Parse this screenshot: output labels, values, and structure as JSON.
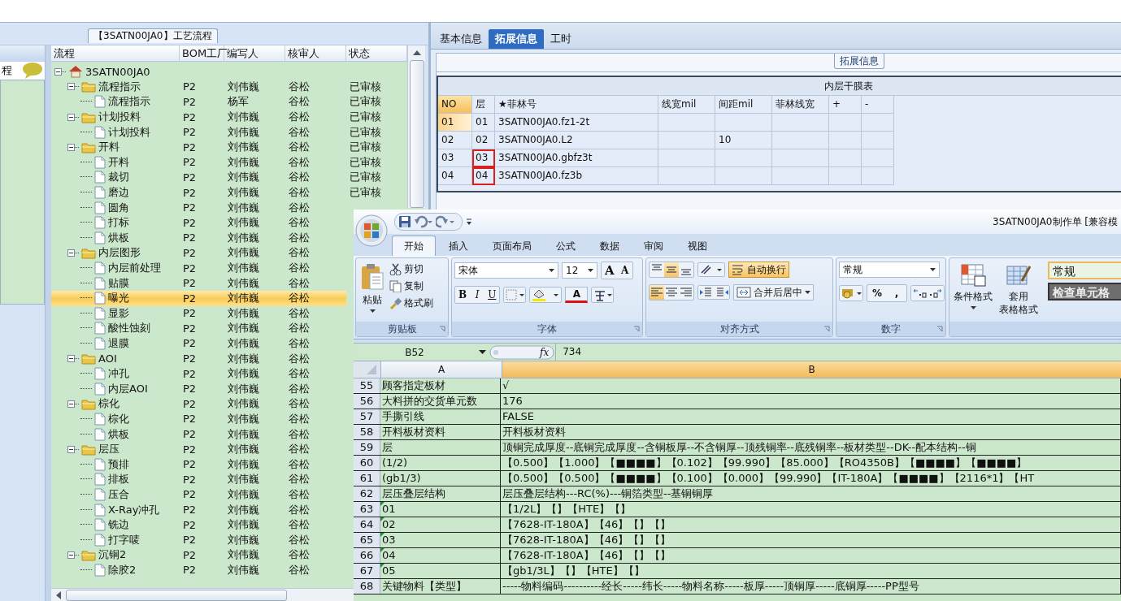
{
  "sidebar": {
    "label": "程"
  },
  "process_panel": {
    "title": "【3SATN00JA0】工艺流程",
    "columns": [
      "流程",
      "BOM工厂",
      "编写人",
      "核审人",
      "状态"
    ],
    "tree": [
      {
        "name": "3SATN00JA0",
        "kind": "root",
        "expanded": true,
        "selected": false,
        "children": [
          {
            "name": "流程指示",
            "kind": "folder",
            "expanded": true,
            "selected": false,
            "bom": "P2",
            "author": "刘伟巍",
            "reviewer": "谷松",
            "status": "已审核",
            "children": [
              {
                "name": "流程指示",
                "kind": "file",
                "selected": false,
                "bom": "P2",
                "author": "杨军",
                "reviewer": "谷松",
                "status": "已审核"
              }
            ]
          },
          {
            "name": "计划投料",
            "kind": "folder",
            "expanded": true,
            "selected": false,
            "bom": "P2",
            "author": "刘伟巍",
            "reviewer": "谷松",
            "status": "已审核",
            "children": [
              {
                "name": "计划投料",
                "kind": "file",
                "selected": false,
                "bom": "P2",
                "author": "刘伟巍",
                "reviewer": "谷松",
                "status": "已审核"
              }
            ]
          },
          {
            "name": "开料",
            "kind": "folder",
            "expanded": true,
            "selected": false,
            "bom": "P2",
            "author": "刘伟巍",
            "reviewer": "谷松",
            "status": "已审核",
            "children": [
              {
                "name": "开料",
                "kind": "file",
                "selected": false,
                "bom": "P2",
                "author": "刘伟巍",
                "reviewer": "谷松",
                "status": "已审核"
              },
              {
                "name": "裁切",
                "kind": "file",
                "selected": false,
                "bom": "P2",
                "author": "刘伟巍",
                "reviewer": "谷松",
                "status": "已审核"
              },
              {
                "name": "磨边",
                "kind": "file",
                "selected": false,
                "bom": "P2",
                "author": "刘伟巍",
                "reviewer": "谷松",
                "status": "已审核"
              },
              {
                "name": "圆角",
                "kind": "file",
                "selected": false,
                "bom": "P2",
                "author": "刘伟巍",
                "reviewer": "谷松"
              },
              {
                "name": "打标",
                "kind": "file",
                "selected": false,
                "bom": "P2",
                "author": "刘伟巍",
                "reviewer": "谷松"
              },
              {
                "name": "烘板",
                "kind": "file",
                "selected": false,
                "bom": "P2",
                "author": "刘伟巍",
                "reviewer": "谷松"
              }
            ]
          },
          {
            "name": "内层图形",
            "kind": "folder",
            "expanded": true,
            "selected": false,
            "bom": "P2",
            "author": "刘伟巍",
            "reviewer": "谷松",
            "children": [
              {
                "name": "内层前处理",
                "kind": "file",
                "selected": false,
                "bom": "P2",
                "author": "刘伟巍",
                "reviewer": "谷松"
              },
              {
                "name": "贴膜",
                "kind": "file",
                "selected": false,
                "bom": "P2",
                "author": "刘伟巍",
                "reviewer": "谷松"
              },
              {
                "name": "曝光",
                "kind": "file",
                "selected": true,
                "bom": "P2",
                "author": "刘伟巍",
                "reviewer": "谷松"
              },
              {
                "name": "显影",
                "kind": "file",
                "selected": false,
                "bom": "P2",
                "author": "刘伟巍",
                "reviewer": "谷松"
              },
              {
                "name": "酸性蚀刻",
                "kind": "file",
                "selected": false,
                "bom": "P2",
                "author": "刘伟巍",
                "reviewer": "谷松"
              },
              {
                "name": "退膜",
                "kind": "file",
                "selected": false,
                "bom": "P2",
                "author": "刘伟巍",
                "reviewer": "谷松"
              }
            ]
          },
          {
            "name": "AOI",
            "kind": "folder",
            "expanded": true,
            "selected": false,
            "bom": "P2",
            "author": "刘伟巍",
            "reviewer": "谷松",
            "children": [
              {
                "name": "冲孔",
                "kind": "file",
                "selected": false,
                "bom": "P2",
                "author": "刘伟巍",
                "reviewer": "谷松"
              },
              {
                "name": "内层AOI",
                "kind": "file",
                "selected": false,
                "bom": "P2",
                "author": "刘伟巍",
                "reviewer": "谷松"
              }
            ]
          },
          {
            "name": "棕化",
            "kind": "folder",
            "expanded": true,
            "selected": false,
            "bom": "P2",
            "author": "刘伟巍",
            "reviewer": "谷松",
            "children": [
              {
                "name": "棕化",
                "kind": "file",
                "selected": false,
                "bom": "P2",
                "author": "刘伟巍",
                "reviewer": "谷松"
              },
              {
                "name": "烘板",
                "kind": "file",
                "selected": false,
                "bom": "P2",
                "author": "刘伟巍",
                "reviewer": "谷松"
              }
            ]
          },
          {
            "name": "层压",
            "kind": "folder",
            "expanded": true,
            "selected": false,
            "bom": "P2",
            "author": "刘伟巍",
            "reviewer": "谷松",
            "children": [
              {
                "name": "预排",
                "kind": "file",
                "selected": false,
                "bom": "P2",
                "author": "刘伟巍",
                "reviewer": "谷松"
              },
              {
                "name": "排板",
                "kind": "file",
                "selected": false,
                "bom": "P2",
                "author": "刘伟巍",
                "reviewer": "谷松"
              },
              {
                "name": "压合",
                "kind": "file",
                "selected": false,
                "bom": "P2",
                "author": "刘伟巍",
                "reviewer": "谷松"
              },
              {
                "name": "X-Ray冲孔",
                "kind": "file",
                "selected": false,
                "bom": "P2",
                "author": "刘伟巍",
                "reviewer": "谷松"
              },
              {
                "name": "铣边",
                "kind": "file",
                "selected": false,
                "bom": "P2",
                "author": "刘伟巍",
                "reviewer": "谷松"
              },
              {
                "name": "打字唛",
                "kind": "file",
                "selected": false,
                "bom": "P2",
                "author": "刘伟巍",
                "reviewer": "谷松"
              }
            ]
          },
          {
            "name": "沉铜2",
            "kind": "folder",
            "expanded": true,
            "selected": false,
            "bom": "P2",
            "author": "刘伟巍",
            "reviewer": "谷松",
            "children": [
              {
                "name": "除胶2",
                "kind": "file",
                "selected": false,
                "bom": "P2",
                "author": "刘伟巍",
                "reviewer": "谷松"
              }
            ]
          }
        ]
      }
    ]
  },
  "info_panel": {
    "tabs": [
      {
        "label": "基本信息",
        "selected": false
      },
      {
        "label": "拓展信息",
        "selected": true
      },
      {
        "label": "工时",
        "selected": false
      }
    ],
    "group_title": "拓展信息",
    "table": {
      "caption": "内层干膜表",
      "columns": [
        {
          "label": "NO",
          "selected": true
        },
        {
          "label": "层",
          "selected": false
        },
        {
          "label": "★菲林号",
          "selected": false
        },
        {
          "label": "线宽mil",
          "selected": false
        },
        {
          "label": "间距mil",
          "selected": false
        },
        {
          "label": "菲林线宽",
          "selected": false
        },
        {
          "label": "+",
          "selected": false
        },
        {
          "label": "-",
          "selected": false
        }
      ],
      "rows": [
        {
          "no": "01",
          "layer": "01",
          "film": "3SATN00JA0.fz1-2t",
          "selected": true,
          "highlighted": false
        },
        {
          "no": "02",
          "layer": "02",
          "film": "3SATN00JA0.L2",
          "spacing": "10",
          "selected": false,
          "highlighted": false
        },
        {
          "no": "03",
          "layer": "03",
          "film": "3SATN00JA0.gbfz3t",
          "selected": false,
          "highlighted": true
        },
        {
          "no": "04",
          "layer": "04",
          "film": "3SATN00JA0.fz3b",
          "selected": false,
          "highlighted": true
        }
      ]
    }
  },
  "excel": {
    "title": "3SATN00JA0制作单  [兼容模",
    "tabs": [
      {
        "label": "开始",
        "selected": true
      },
      {
        "label": "插入",
        "selected": false
      },
      {
        "label": "页面布局",
        "selected": false
      },
      {
        "label": "公式",
        "selected": false
      },
      {
        "label": "数据",
        "selected": false
      },
      {
        "label": "审阅",
        "selected": false
      },
      {
        "label": "视图",
        "selected": false
      }
    ],
    "clipboard": {
      "label": "剪贴板",
      "paste": "粘贴",
      "cut": "剪切",
      "copy": "复制",
      "format_painter": "格式刷"
    },
    "font": {
      "label": "字体",
      "name": "宋体",
      "size": "12",
      "grow": "A",
      "shrink": "A",
      "bold": "B",
      "italic": "I",
      "underline": "U",
      "font_color": "A"
    },
    "alignment": {
      "label": "对齐方式",
      "vertical": [
        {
          "selected": false
        },
        {
          "selected": true
        },
        {
          "selected": false
        }
      ],
      "horizontal": [
        {
          "selected": true
        },
        {
          "selected": false
        },
        {
          "selected": false
        }
      ],
      "wrap_text": "自动换行",
      "wrap_on": true,
      "merge": "合并后居中"
    },
    "number": {
      "label": "数字",
      "format": "常规",
      "percent": "%",
      "comma": ","
    },
    "styles": {
      "conditional": "条件格式",
      "table_format": [
        "套用",
        "表格格式"
      ],
      "normal": "常规",
      "check_cell": "检查单元格"
    },
    "formula_bar": {
      "cell": "B52",
      "fx": "fx",
      "value": "734"
    },
    "sheet": {
      "columns": [
        {
          "label": "A",
          "selected": false
        },
        {
          "label": "B",
          "selected": true
        }
      ],
      "rows": [
        {
          "num": "55",
          "a": "顾客指定板材",
          "b": "√",
          "marked": false
        },
        {
          "num": "56",
          "a": "大料拼的交货单元数",
          "b": "176",
          "marked": false
        },
        {
          "num": "57",
          "a": "手撕引线",
          "b": "FALSE",
          "marked": false
        },
        {
          "num": "58",
          "a": "开料板材资料",
          "b": "开料板材资料",
          "marked": false
        },
        {
          "num": "59",
          "a": "层",
          "b": "顶铜完成厚度--底铜完成厚度--含铜板厚--不含铜厚--顶残铜率--底残铜率--板材类型--DK--配本结构--铜",
          "marked": false
        },
        {
          "num": "60",
          "a": "(1/2)",
          "b": "【0.500】【1.000】【■■■■】【0.102】【99.990】【85.000】【RO4350B】【■■■■】【■■■■】",
          "marked": false
        },
        {
          "num": "61",
          "a": "(gb1/3)",
          "b": "【0.500】【0.500】【■■■■】【0.100】【0.000】【99.990】【IT-180A】【■■■■】【2116*1】【HT",
          "marked": false
        },
        {
          "num": "62",
          "a": "层压叠层结构",
          "b": "层压叠层结构---RC(%)---铜箔类型--基铜铜厚",
          "marked": false
        },
        {
          "num": "63",
          "a": "01",
          "b": "【1/2L】【】【HTE】【】",
          "marked": true
        },
        {
          "num": "64",
          "a": "02",
          "b": "【7628-IT-180A】【46】【】【】",
          "marked": true
        },
        {
          "num": "65",
          "a": "03",
          "b": "【7628-IT-180A】【46】【】【】",
          "marked": true
        },
        {
          "num": "66",
          "a": "04",
          "b": "【7628-IT-180A】【46】【】【】",
          "marked": true
        },
        {
          "num": "67",
          "a": "05",
          "b": "【gb1/3L】【】【HTE】【】",
          "marked": true
        },
        {
          "num": "68",
          "a": "关键物料【类型】",
          "b": "-----物料编码----------经长-----纬长-----物料名称-----板厚-----顶铜厚-----底铜厚-----PP型号",
          "marked": false
        }
      ]
    }
  }
}
